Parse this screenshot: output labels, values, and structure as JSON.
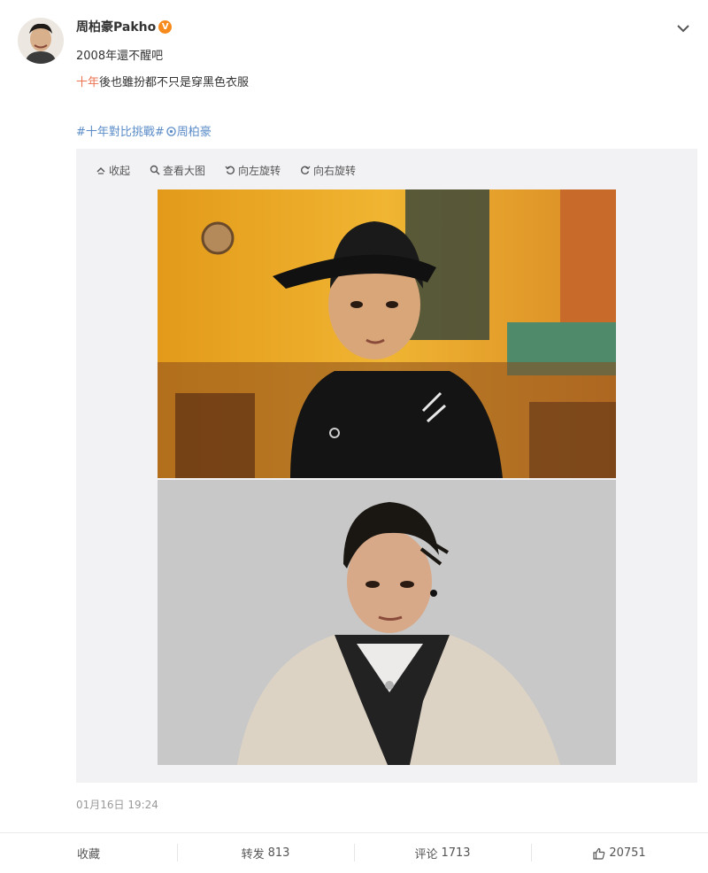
{
  "author": {
    "name": "周柏豪Pakho",
    "verified_badge": "V"
  },
  "post": {
    "line1": "2008年還不醒吧",
    "line2_highlight": "十年",
    "line2_rest": "後也雖扮都不只是穿黑色衣服",
    "topics": [
      {
        "label": "#十年對比挑戰#"
      },
      {
        "label": "周柏豪"
      }
    ]
  },
  "media_toolbar": {
    "collapse": "收起",
    "view_large": "查看大图",
    "rotate_left": "向左旋转",
    "rotate_right": "向右旋转"
  },
  "timestamp": "01月16日 19:24",
  "actions": {
    "favorite": "收藏",
    "repost_label": "转发",
    "repost_count": "813",
    "comment_label": "评论",
    "comment_count": "1713",
    "like_count": "20751"
  },
  "colors": {
    "highlight": "#eb7350",
    "topic_link": "#5b8cc8",
    "verified_badge": "#f78a1d",
    "media_panel_bg": "#f2f2f5"
  }
}
